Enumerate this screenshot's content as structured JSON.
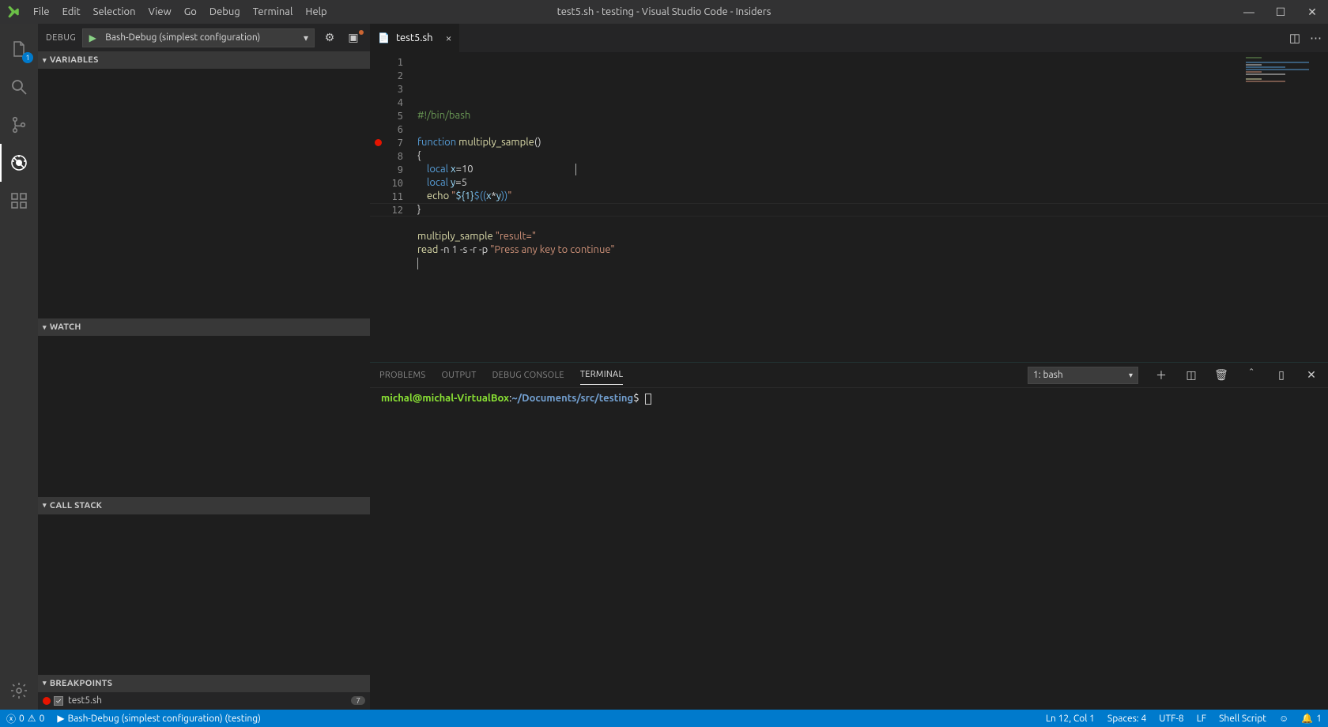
{
  "window": {
    "title": "test5.sh - testing - Visual Studio Code - Insiders"
  },
  "menu": [
    "File",
    "Edit",
    "Selection",
    "View",
    "Go",
    "Debug",
    "Terminal",
    "Help"
  ],
  "activity": {
    "explorer_badge": "1"
  },
  "debug": {
    "title": "DEBUG",
    "config": "Bash-Debug (simplest configuration)",
    "sections": {
      "variables": "VARIABLES",
      "watch": "WATCH",
      "callstack": "CALL STACK",
      "breakpoints": "BREAKPOINTS"
    },
    "breakpoints": [
      {
        "file": "test5.sh",
        "line": "7"
      }
    ]
  },
  "tab": {
    "file": "test5.sh"
  },
  "editor": {
    "total_lines": 12,
    "breakpoint_line": 7,
    "current_line": 12,
    "code_tokens": [
      [
        [
          "k-grn",
          "#!/bin/bash"
        ]
      ],
      [],
      [
        [
          "k-blue",
          "function "
        ],
        [
          "k-yel",
          "multiply_sample"
        ],
        [
          "k-txt",
          "()"
        ]
      ],
      [
        [
          "k-txt",
          "{"
        ]
      ],
      [
        [
          "k-txt",
          "    "
        ],
        [
          "k-blue",
          "local"
        ],
        [
          "k-txt",
          " "
        ],
        [
          "k-var",
          "x"
        ],
        [
          "k-txt",
          "="
        ],
        [
          "k-txt",
          "10"
        ]
      ],
      [
        [
          "k-txt",
          "    "
        ],
        [
          "k-blue",
          "local"
        ],
        [
          "k-txt",
          " "
        ],
        [
          "k-var",
          "y"
        ],
        [
          "k-txt",
          "="
        ],
        [
          "k-txt",
          "5"
        ]
      ],
      [
        [
          "k-txt",
          "    "
        ],
        [
          "k-yel",
          "echo"
        ],
        [
          "k-txt",
          " "
        ],
        [
          "k-str",
          "\""
        ],
        [
          "k-var",
          "${1}"
        ],
        [
          "k-blue",
          "$(("
        ],
        [
          "k-var",
          "x"
        ],
        [
          "k-txt",
          "*"
        ],
        [
          "k-var",
          "y"
        ],
        [
          "k-blue",
          "))"
        ],
        [
          "k-str",
          "\""
        ]
      ],
      [
        [
          "k-txt",
          "}"
        ]
      ],
      [],
      [
        [
          "k-yel",
          "multiply_sample"
        ],
        [
          "k-txt",
          " "
        ],
        [
          "k-str",
          "\"result=\""
        ]
      ],
      [
        [
          "k-yel",
          "read"
        ],
        [
          "k-txt",
          " -n 1 -s -r -p "
        ],
        [
          "k-str",
          "\"Press any key to continue\""
        ]
      ],
      []
    ]
  },
  "panel": {
    "tabs": [
      "PROBLEMS",
      "OUTPUT",
      "DEBUG CONSOLE",
      "TERMINAL"
    ],
    "active": "TERMINAL",
    "terminal_selector": "1: bash",
    "prompt": {
      "userhost": "michal@michal-VirtualBox",
      "path": "~/Documents/src/testing"
    }
  },
  "status": {
    "errors": "0",
    "warnings": "0",
    "launch": "Bash-Debug (simplest configuration) (testing)",
    "ln_col": "Ln 12, Col 1",
    "spaces": "Spaces: 4",
    "encoding": "UTF-8",
    "eol": "LF",
    "language": "Shell Script",
    "notifications": "1"
  }
}
